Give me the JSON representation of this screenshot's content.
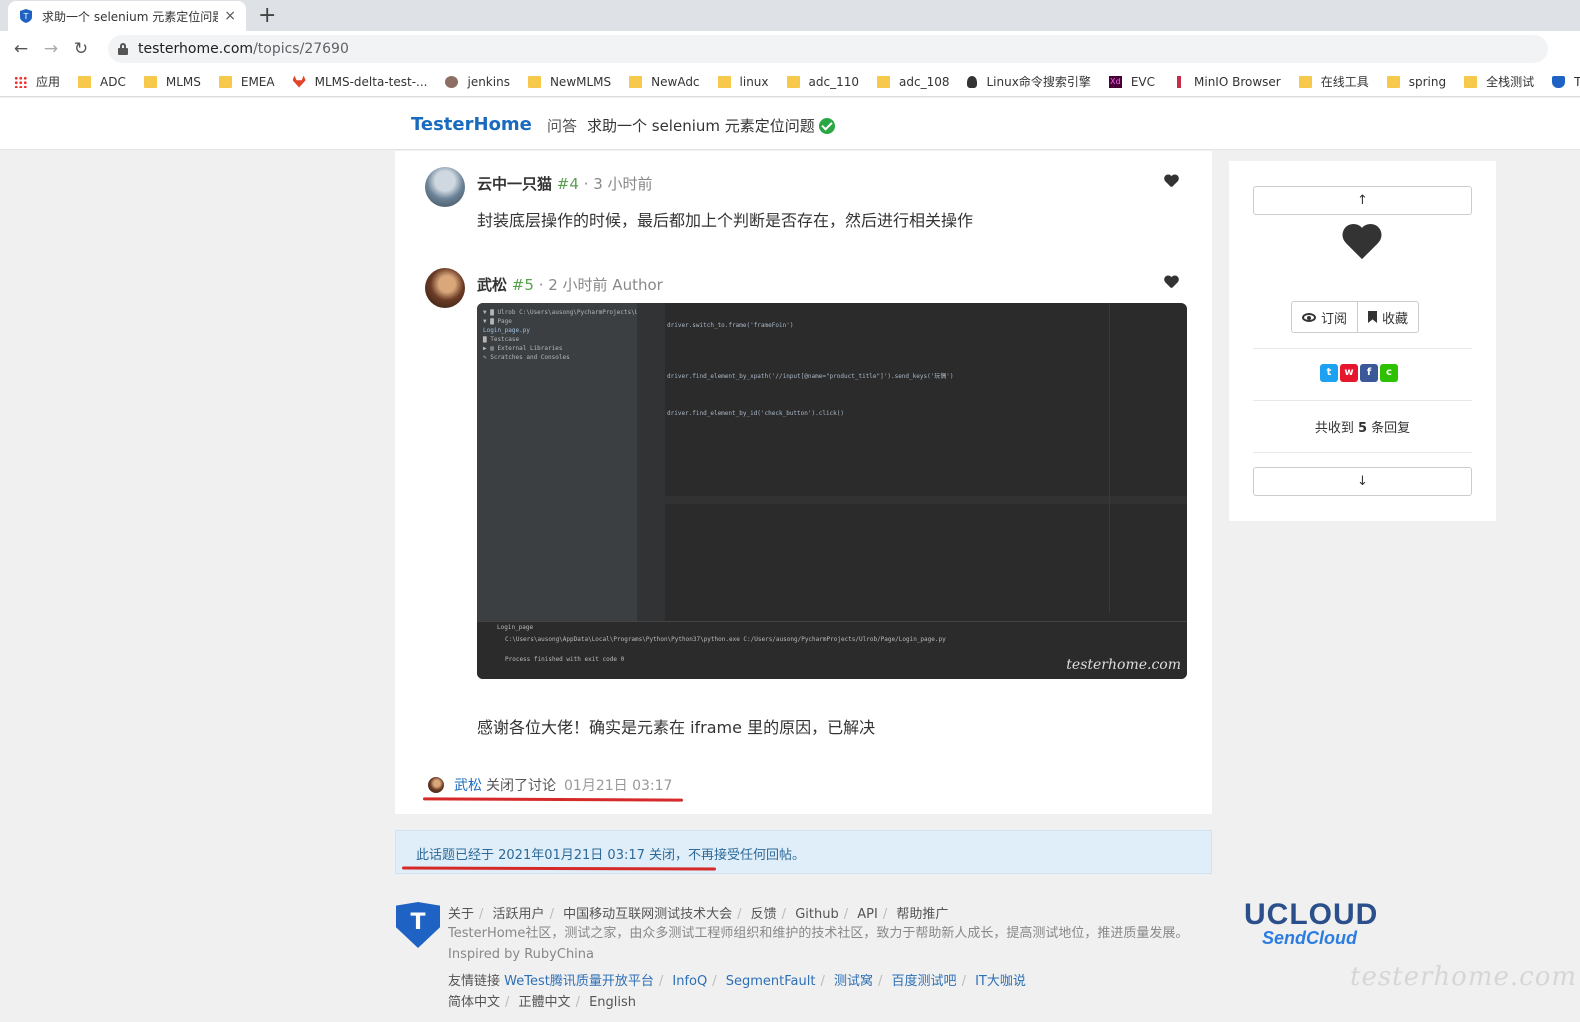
{
  "browser": {
    "tab_title": "求助一个 selenium 元素定位问题",
    "tab_close": "×",
    "new_tab": "+",
    "back": "←",
    "forward": "→",
    "reload": "↻",
    "url_host": "testerhome.com",
    "url_path": "/topics/27690",
    "bookmarks": [
      "应用",
      "ADC",
      "MLMS",
      "EMEA",
      "MLMS-delta-test-...",
      "jenkins",
      "NewMLMS",
      "NewAdc",
      "linux",
      "adc_110",
      "adc_108",
      "Linux命令搜索引擎",
      "EVC",
      "MinIO Browser",
      "在线工具",
      "spring",
      "全栈测试",
      "T"
    ]
  },
  "site": {
    "brand": "TesterHome",
    "node": "问答",
    "topic_title": "求助一个 selenium 元素定位问题"
  },
  "replies": [
    {
      "author": "云中一只猫",
      "floor": "#4",
      "meta": " · 3 小时前",
      "body": "封装底层操作的时候，最后都加上个判断是否存在，然后进行相关操作"
    },
    {
      "author": "武松",
      "floor": "#5",
      "meta": " · 2 小时前 Author",
      "body": "感谢各位大佬！确实是元素在 iframe 里的原因，已解决"
    }
  ],
  "ide": {
    "tree": [
      "▼ ▇ Ulrob  C:\\Users\\ausong\\PycharmProjects\\Ulrob",
      "  ▼ ▇ Page",
      "      Login_page.py",
      "    ▇ Testcase",
      "▶ ▥ External Libraries",
      "  ✎ Scratches and Consoles"
    ],
    "code": [
      "driver.switch_to.frame('frameFoin')",
      "driver.find_element_by_xpath('//input[@name=\"product_title\"]').send_keys('玩偶')",
      "driver.find_element_by_id('check_button').click()"
    ],
    "run_tab": "Login_page",
    "run_lines": [
      "C:\\Users\\ausong\\AppData\\Local\\Programs\\Python\\Python37\\python.exe C:/Users/ausong/PycharmProjects/Ulrob/Page/Login_page.py",
      "Process finished with exit code 0"
    ],
    "watermark": "testerhome.com"
  },
  "close_event": {
    "who": "武松",
    "action": "关闭了讨论",
    "time": "01月21日 03:17"
  },
  "closed_notice": "此话题已经于 2021年01月21日 03:17 关闭，不再接受任何回帖。",
  "sidebar": {
    "up": "↑",
    "down": "↓",
    "subscribe": "订阅",
    "favorite": "收藏",
    "reply_prefix": "共收到",
    "reply_count": "5",
    "reply_suffix": "条回复"
  },
  "footer": {
    "logo_letter": "T",
    "links": [
      "关于",
      "活跃用户",
      "中国移动互联网测试技术大会",
      "反馈",
      "Github",
      "API",
      "帮助推广"
    ],
    "description": "TesterHome社区，测试之家，由众多测试工程师组织和维护的技术社区，致力于帮助新人成长，提高测试地位，推进质量发展。Inspired by RubyChina",
    "friends_label": "友情链接",
    "friends": [
      "WeTest腾讯质量开放平台",
      "InfoQ",
      "SegmentFault",
      "测试窝",
      "百度测试吧",
      "IT大咖说"
    ],
    "languages": [
      "简体中文",
      "正體中文",
      "English"
    ],
    "sponsor_top": "UCLOUD",
    "sponsor_bottom": "SendCloud",
    "watermark": "testerhome.com"
  }
}
